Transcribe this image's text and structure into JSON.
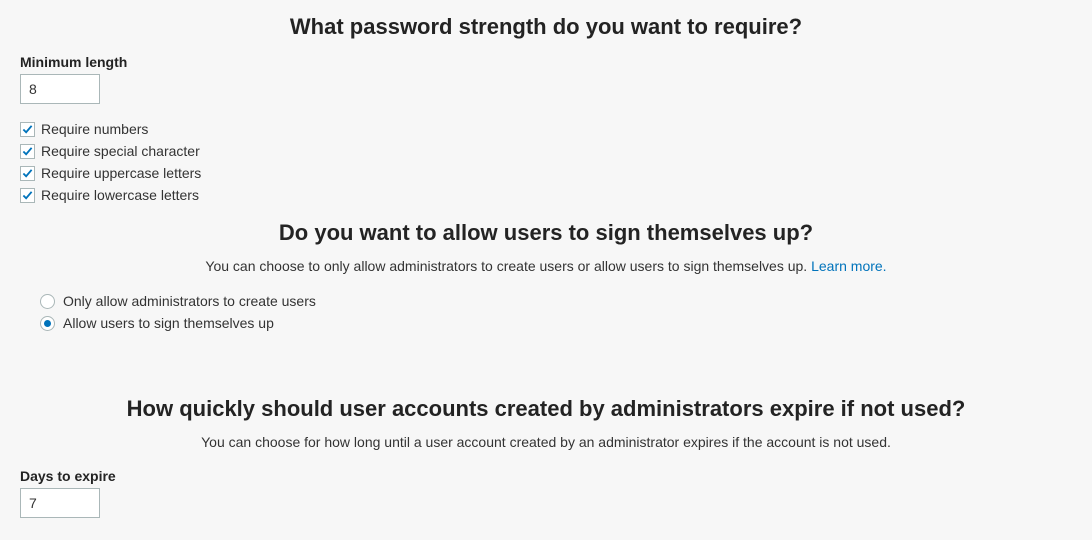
{
  "password_strength": {
    "heading": "What password strength do you want to require?",
    "min_length_label": "Minimum length",
    "min_length_value": "8",
    "require_numbers": "Require numbers",
    "require_special": "Require special character",
    "require_upper": "Require uppercase letters",
    "require_lower": "Require lowercase letters"
  },
  "signup": {
    "heading": "Do you want to allow users to sign themselves up?",
    "sub": "You can choose to only allow administrators to create users or allow users to sign themselves up. ",
    "learn_more": "Learn more.",
    "admin_only": "Only allow administrators to create users",
    "self_signup": "Allow users to sign themselves up"
  },
  "expire": {
    "heading": "How quickly should user accounts created by administrators expire if not used?",
    "sub": "You can choose for how long until a user account created by an administrator expires if the account is not used.",
    "days_label": "Days to expire",
    "days_value": "7"
  }
}
